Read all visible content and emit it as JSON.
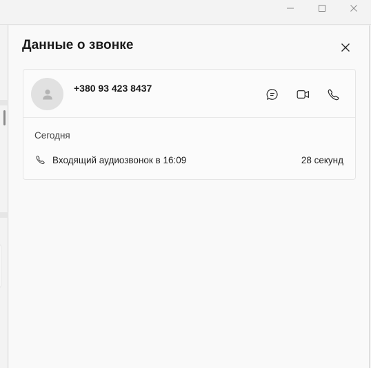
{
  "window": {
    "controls": {
      "minimize_icon": "minimize-icon",
      "maximize_icon": "maximize-icon",
      "close_icon": "close-icon"
    }
  },
  "panel": {
    "title": "Данные о звонке",
    "close_icon": "close-icon"
  },
  "contact": {
    "phone": "+380 93 423 8437",
    "avatar_icon": "person-icon",
    "actions": [
      {
        "name": "chat",
        "icon": "chat-bubble-icon"
      },
      {
        "name": "video-call",
        "icon": "video-camera-icon"
      },
      {
        "name": "audio-call",
        "icon": "phone-icon"
      }
    ]
  },
  "history": {
    "day": "Сегодня",
    "calls": [
      {
        "icon": "phone-icon",
        "description": "Входящий аудиозвонок в 16:09",
        "duration": "28 секунд"
      }
    ]
  },
  "colors": {
    "background": "#f3f3f3",
    "panel": "#f9f9f9",
    "card": "#fbfbfb",
    "avatar": "#e1e1e1",
    "text": "#1b1b1b"
  }
}
